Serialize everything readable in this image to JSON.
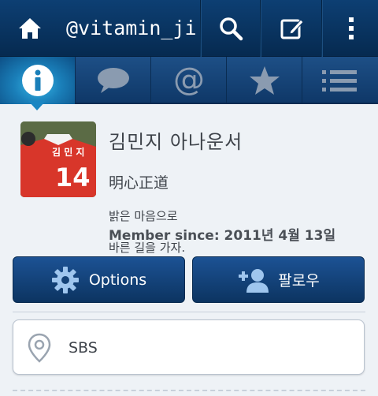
{
  "app_bar": {
    "title": "@vitamin_ji",
    "home_icon": "home-icon",
    "actions": [
      "search-icon",
      "compose-icon",
      "overflow-menu-icon"
    ]
  },
  "tabs": [
    {
      "icon": "info-icon",
      "active": true
    },
    {
      "icon": "messages-icon",
      "active": false
    },
    {
      "icon": "mentions-icon",
      "active": false
    },
    {
      "icon": "favorites-icon",
      "active": false
    },
    {
      "icon": "list-icon",
      "active": false
    }
  ],
  "profile": {
    "name": "김민지 아나운서",
    "bio_line1": "明心正道",
    "bio_line2": "밝은 마음으로",
    "bio_line3": "바른 길을 가자.",
    "member_since": "Member since: 2011년 4월 13일",
    "jersey_text": "김 민 지",
    "jersey_number": "14"
  },
  "buttons": {
    "options_label": "Options",
    "follow_label": "팔로우"
  },
  "location": {
    "value": "SBS"
  },
  "colors": {
    "bar_dark": "#062a50",
    "tab_active": "#1a86c2",
    "button": "#0c3461",
    "text": "#3e434a"
  }
}
